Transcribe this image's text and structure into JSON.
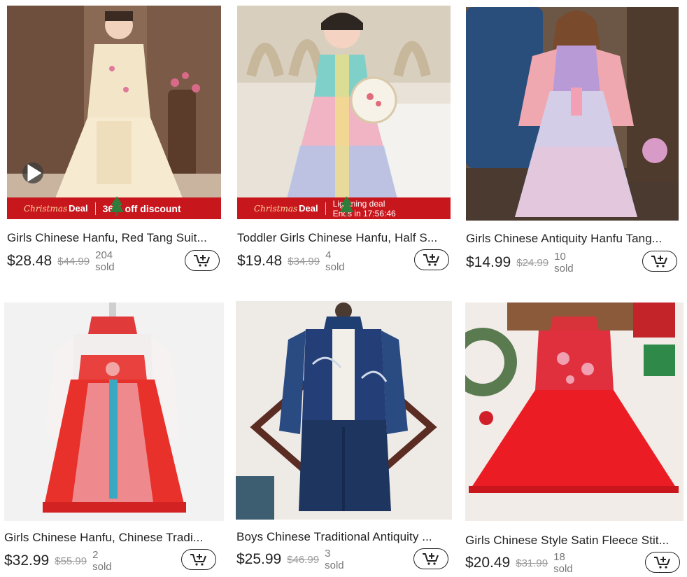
{
  "products": [
    {
      "title": "Girls Chinese Hanfu, Red Tang Suit...",
      "price": "$28.48",
      "original_price": "$44.99",
      "sold": "204 sold",
      "banner": {
        "christmas": "Christmas",
        "deal": "Deal",
        "text": "36% off discount"
      },
      "has_video": true
    },
    {
      "title": "Toddler Girls Chinese Hanfu, Half S...",
      "price": "$19.48",
      "original_price": "$34.99",
      "sold": "4 sold",
      "banner": {
        "christmas": "Christmas",
        "deal": "Deal",
        "line1": "Lightning deal",
        "line2": "Ends in 17:56:46"
      }
    },
    {
      "title": "Girls Chinese Antiquity Hanfu Tang...",
      "price": "$14.99",
      "original_price": "$24.99",
      "sold": "10 sold"
    },
    {
      "title": "Girls Chinese Hanfu, Chinese Tradi...",
      "price": "$32.99",
      "original_price": "$55.99",
      "sold": "2 sold"
    },
    {
      "title": "Boys Chinese Traditional Antiquity ...",
      "price": "$25.99",
      "original_price": "$46.99",
      "sold": "3 sold"
    },
    {
      "title": "Girls Chinese Style Satin Fleece Stit...",
      "price": "$20.49",
      "original_price": "$31.99",
      "sold": "18 sold"
    }
  ],
  "icons": {
    "cart": "add-to-cart-icon",
    "play": "play-icon",
    "tree": "christmas-tree-icon"
  },
  "colors": {
    "banner_red": "#c8161d",
    "text": "#222222",
    "muted": "#999999"
  }
}
